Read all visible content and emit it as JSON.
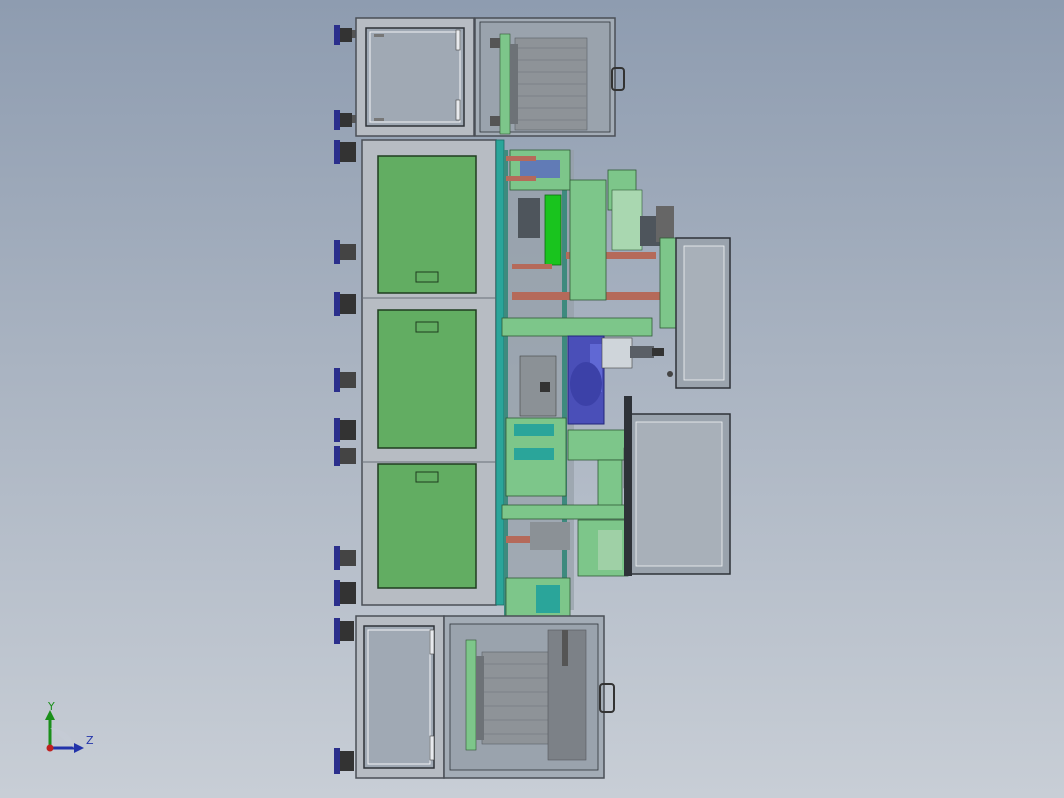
{
  "viewport": {
    "colors": {
      "frame_gray": "#b7bcc3",
      "frame_dark": "#4a4f56",
      "panel_green": "#62ad62",
      "bright_green": "#19c41e",
      "machine_green": "#7dc68a",
      "teal": "#2aa59a",
      "rod_red": "#b56a5a",
      "motor_blue": "#4a4fb8",
      "foot_blue": "#2b2f8c",
      "glass_gray": "#9aa3ad",
      "coil_gray": "#8e9398"
    }
  },
  "triad": {
    "y_label": "Y",
    "z_label": "Z",
    "icon": "coordinate-triad-icon"
  }
}
